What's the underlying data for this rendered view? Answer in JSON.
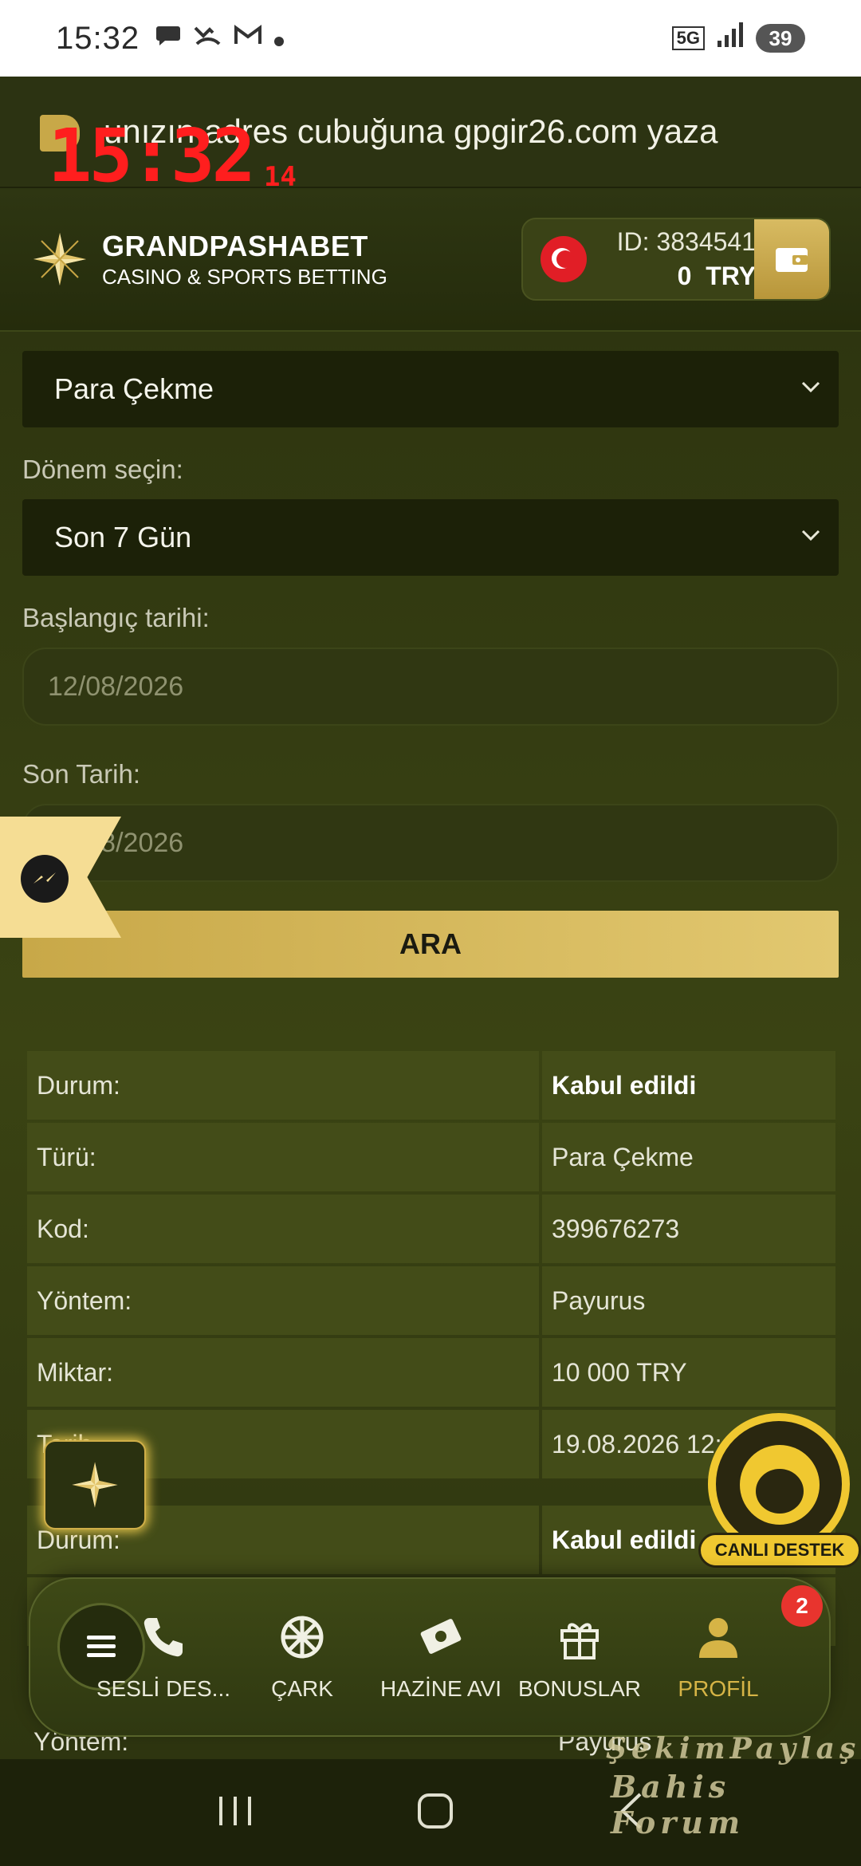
{
  "status_bar": {
    "time": "15:32",
    "network": "5G",
    "battery": "39"
  },
  "marquee": {
    "text": "unızın adres cubuğuna gpgir26.com yaza"
  },
  "overlay_clock": {
    "time": "15:32",
    "seconds": "14"
  },
  "header": {
    "brand_name": "GRANDPASHABET",
    "brand_tagline": "CASINO & SPORTS BETTING",
    "account_id": "ID: 3834541",
    "balance_amount": "0",
    "balance_currency": "TRY"
  },
  "form": {
    "type_value": "Para Çekme",
    "period_label": "Dönem seçin:",
    "period_value": "Son 7 Gün",
    "start_label": "Başlangıç tarihi:",
    "start_placeholder": "12/08/2026",
    "end_label": "Son Tarih:",
    "end_placeholder": "19/08/2026",
    "search_button": "ARA"
  },
  "transactions": [
    {
      "rows": [
        {
          "key": "Durum:",
          "value": "Kabul edildi"
        },
        {
          "key": "Türü:",
          "value": "Para Çekme"
        },
        {
          "key": "Kod:",
          "value": "399676273"
        },
        {
          "key": "Yöntem:",
          "value": "Payurus"
        },
        {
          "key": "Miktar:",
          "value": "10 000 TRY"
        },
        {
          "key": "Tarih",
          "value": "19.08.2026 12:"
        }
      ]
    },
    {
      "rows": [
        {
          "key": "Durum:",
          "value": "Kabul edildi"
        },
        {
          "key": "Yöntem:",
          "value": "Payurus"
        }
      ]
    }
  ],
  "live_support": {
    "label": "CANLI DESTEK"
  },
  "bottom_nav": {
    "items": [
      {
        "label": "SESLİ DES..."
      },
      {
        "label": "ÇARK"
      },
      {
        "label": "HAZİNE AVI"
      },
      {
        "label": "BONUSLAR"
      },
      {
        "label": "PROFİL"
      }
    ],
    "profile_badge": "2"
  },
  "watermark": {
    "line1": "ŞekimPaylaş",
    "line2": "Bahis Forum"
  },
  "colors": {
    "accent": "#d6b446",
    "background": "#2f3611",
    "badge": "#e8342e",
    "clock": "#ff1e1e"
  }
}
